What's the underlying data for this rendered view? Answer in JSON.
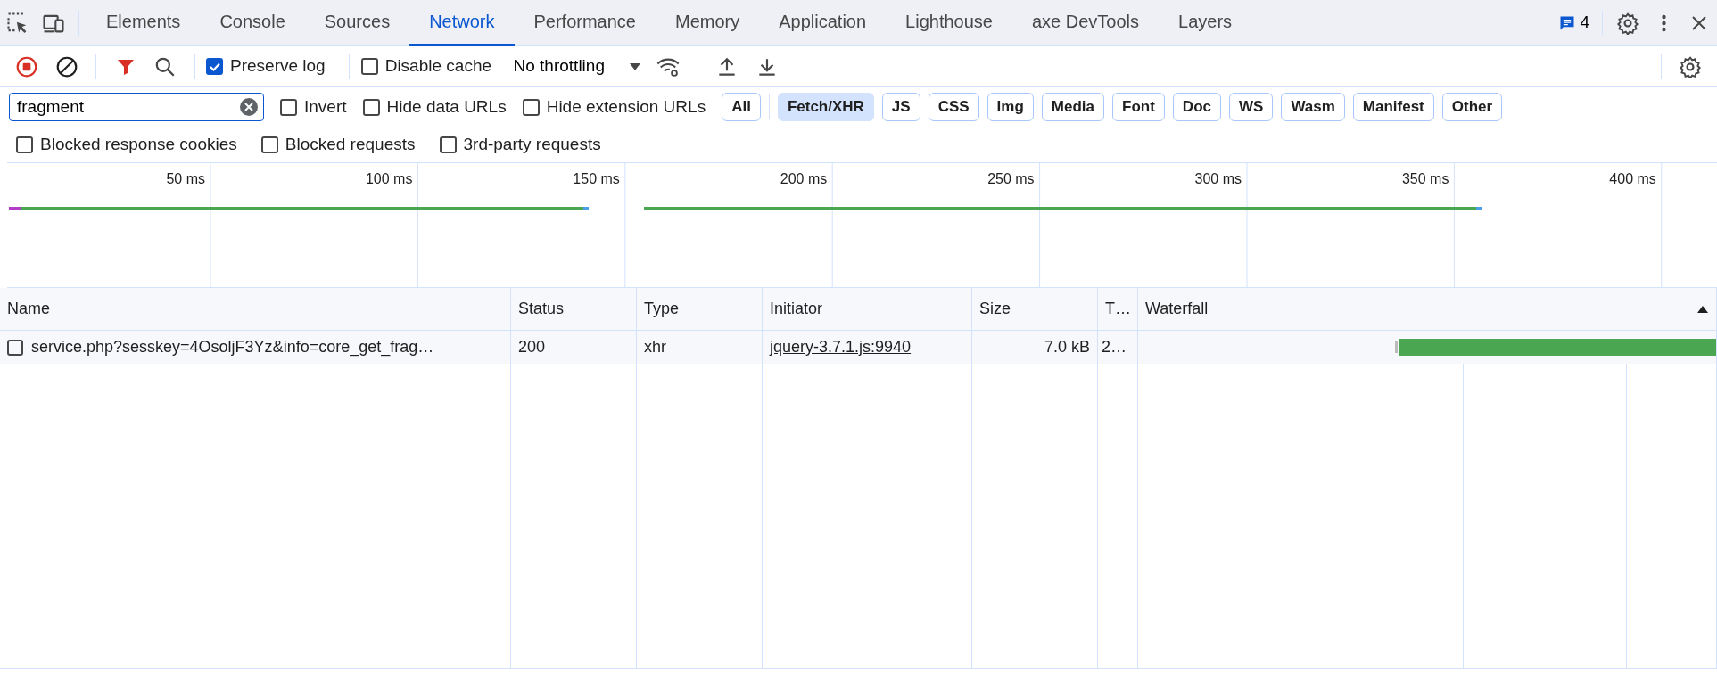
{
  "tabs": [
    {
      "label": "Elements",
      "selected": false
    },
    {
      "label": "Console",
      "selected": false
    },
    {
      "label": "Sources",
      "selected": false
    },
    {
      "label": "Network",
      "selected": true
    },
    {
      "label": "Performance",
      "selected": false
    },
    {
      "label": "Memory",
      "selected": false
    },
    {
      "label": "Application",
      "selected": false
    },
    {
      "label": "Lighthouse",
      "selected": false
    },
    {
      "label": "axe DevTools",
      "selected": false
    },
    {
      "label": "Layers",
      "selected": false
    }
  ],
  "issues_count": "4",
  "toolbar": {
    "recording": true,
    "options": [
      {
        "label": "Preserve log",
        "checked": true
      },
      {
        "label": "Disable cache",
        "checked": false
      }
    ],
    "throttling": "No throttling"
  },
  "filter": {
    "value": "fragment",
    "options": [
      {
        "label": "Invert",
        "checked": false
      },
      {
        "label": "Hide data URLs",
        "checked": false
      },
      {
        "label": "Hide extension URLs",
        "checked": false
      }
    ],
    "types": [
      {
        "label": "All",
        "selected": false
      },
      {
        "label": "Fetch/XHR",
        "selected": true
      },
      {
        "label": "JS",
        "selected": false
      },
      {
        "label": "CSS",
        "selected": false
      },
      {
        "label": "Img",
        "selected": false
      },
      {
        "label": "Media",
        "selected": false
      },
      {
        "label": "Font",
        "selected": false
      },
      {
        "label": "Doc",
        "selected": false
      },
      {
        "label": "WS",
        "selected": false
      },
      {
        "label": "Wasm",
        "selected": false
      },
      {
        "label": "Manifest",
        "selected": false
      },
      {
        "label": "Other",
        "selected": false
      }
    ],
    "more_options": [
      {
        "label": "Blocked response cookies",
        "checked": false
      },
      {
        "label": "Blocked requests",
        "checked": false
      },
      {
        "label": "3rd-party requests",
        "checked": false
      }
    ]
  },
  "overview": {
    "ticks": [
      "50 ms",
      "100 ms",
      "150 ms",
      "200 ms",
      "250 ms",
      "300 ms",
      "350 ms",
      "400 ms"
    ]
  },
  "table": {
    "columns": [
      "Name",
      "Status",
      "Type",
      "Initiator",
      "Size",
      "T…",
      "Waterfall"
    ],
    "rows": [
      {
        "name": "service.php?sesskey=4OsoljF3Yz&info=core_get_frag…",
        "status": "200",
        "type": "xhr",
        "initiator": "jquery-3.7.1.js:9940",
        "size": "7.0 kB",
        "time": "2…",
        "checked": false
      }
    ]
  }
}
